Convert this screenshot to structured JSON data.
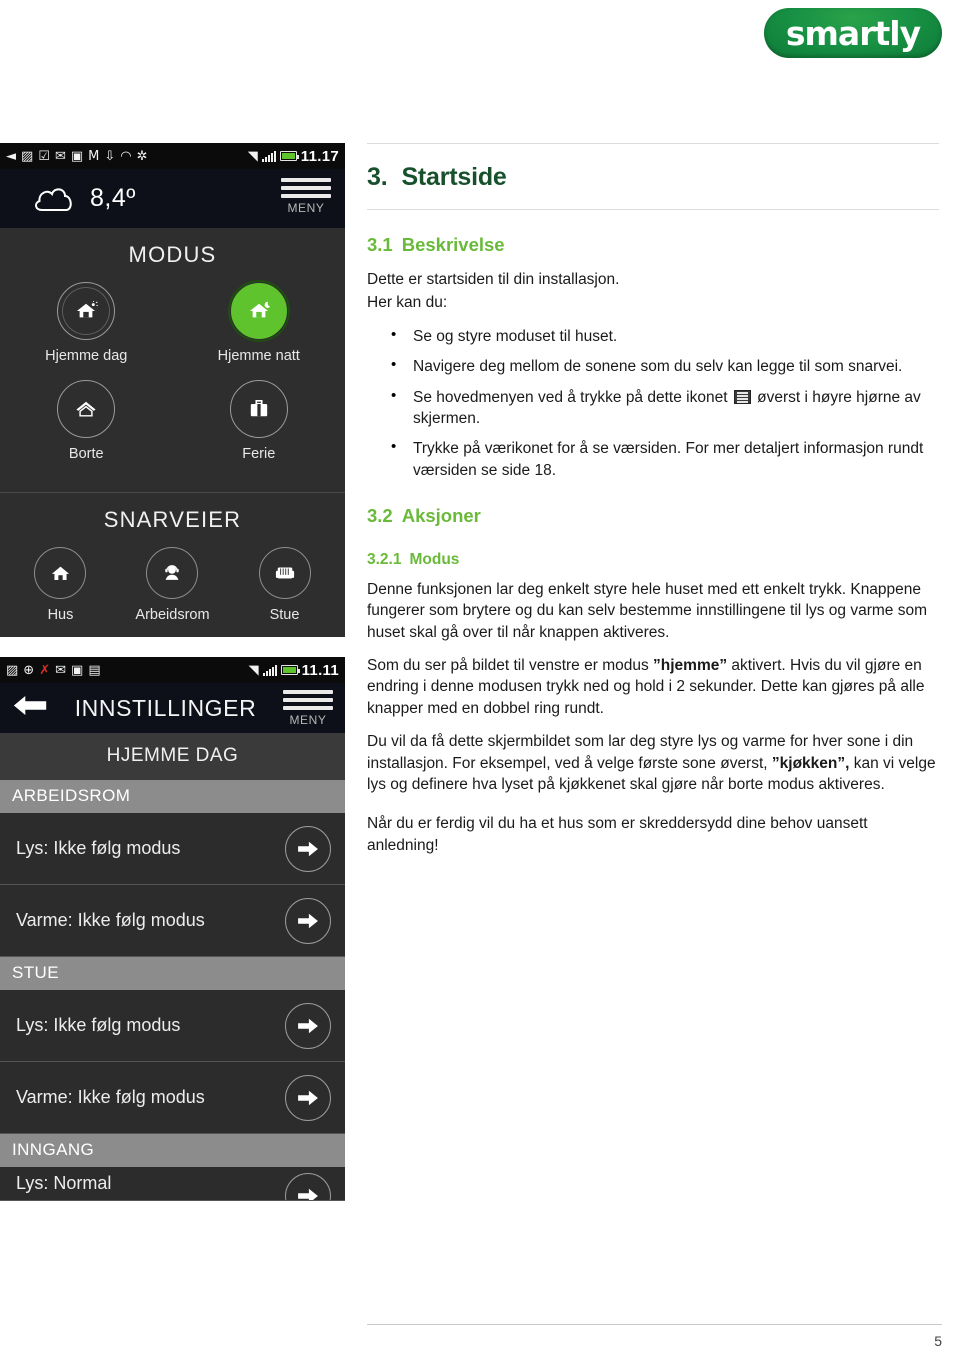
{
  "brand": {
    "name": "smartly",
    "color": "#108040"
  },
  "colors": {
    "heading_dark_green": "#16512c",
    "heading_green": "#6aba3a",
    "accent_green": "#5ec32c"
  },
  "phone_home": {
    "status_bar": {
      "time": "11.17",
      "icons": [
        "back-icon",
        "message-icon",
        "checkbox-icon",
        "envelope-icon",
        "code-icon",
        "gmail-icon",
        "usb-icon",
        "headset-icon",
        "bluetooth-icon",
        "wifi-icon",
        "signal-icon",
        "battery-icon"
      ]
    },
    "weather": {
      "temperature": "8,4º",
      "icon": "cloud-icon"
    },
    "menu_label": "MENY",
    "modus": {
      "title": "MODUS",
      "buttons": [
        {
          "label": "Hjemme dag",
          "icon": "house-sun-icon",
          "active": false
        },
        {
          "label": "Hjemme natt",
          "icon": "house-moon-icon",
          "active": true
        },
        {
          "label": "Borte",
          "icon": "house-icon",
          "active": false
        },
        {
          "label": "Ferie",
          "icon": "suitcase-icon",
          "active": false
        }
      ]
    },
    "snarveier": {
      "title": "SNARVEIER",
      "buttons": [
        {
          "label": "Hus",
          "icon": "house-filled-icon"
        },
        {
          "label": "Arbeidsrom",
          "icon": "person-headset-icon"
        },
        {
          "label": "Stue",
          "icon": "armchair-icon"
        }
      ]
    }
  },
  "phone_settings": {
    "status_bar": {
      "time": "11.11",
      "icons": [
        "message-icon",
        "download-icon",
        "missed-call-icon",
        "envelope-icon",
        "save-icon",
        "clipboard-icon",
        "wifi-icon",
        "signal-icon",
        "battery-icon"
      ]
    },
    "header": {
      "title": "INNSTILLINGER",
      "back_icon": "back-arrow-icon",
      "menu_label": "MENY"
    },
    "subtitle": "HJEMME DAG",
    "sections": [
      {
        "name": "ARBEIDSROM",
        "rows": [
          {
            "label": "Lys: Ikke følg modus",
            "action_icon": "arrow-right-icon"
          },
          {
            "label": "Varme: Ikke følg modus",
            "action_icon": "arrow-right-icon"
          }
        ]
      },
      {
        "name": "STUE",
        "rows": [
          {
            "label": "Lys: Ikke følg modus",
            "action_icon": "arrow-right-icon"
          },
          {
            "label": "Varme: Ikke følg modus",
            "action_icon": "arrow-right-icon"
          }
        ]
      },
      {
        "name": "INNGANG",
        "rows": [
          {
            "label": "Lys: Normal",
            "action_icon": "arrow-right-icon"
          }
        ]
      }
    ]
  },
  "doc": {
    "h1": {
      "num": "3.",
      "text": "Startside"
    },
    "s31": {
      "num": "3.1",
      "text": "Beskrivelse"
    },
    "intro_line1": "Dette er startsiden til din installasjon.",
    "intro_line2": "Her kan du:",
    "bullets": {
      "b1": "Se og styre moduset til huset.",
      "b2": "Navigere deg mellom de sonene som du selv kan legge til som snarvei.",
      "b3a": "Se hovedmenyen ved å trykke på dette ikonet",
      "b3b": "øverst i høyre hjørne av skjermen.",
      "b4": "Trykke på værikonet for å se værsiden. For mer detaljert informasjon rundt værsiden se side 18."
    },
    "s32": {
      "num": "3.2",
      "text": "Aksjoner"
    },
    "s321": {
      "num": "3.2.1",
      "text": "Modus"
    },
    "p1": "Denne funksjonen lar deg enkelt styre hele huset med ett enkelt trykk. Knappene fungerer som brytere og du kan selv bestemme innstillingene til lys og varme som huset skal gå over til når knappen aktiveres.",
    "p2a": "Som du ser på bildet til venstre er modus ",
    "p2b": "”hjemme”",
    "p2c": " aktivert. Hvis du vil gjøre en endring i denne modusen trykk ned og hold i 2 sekunder. Dette kan gjøres på alle knapper med en dobbel ring rundt.",
    "p3a": "Du vil da få dette skjermbildet som lar deg styre lys og varme for hver sone i din installasjon. For eksempel, ved å velge første sone øverst, ",
    "p3b": "”kjøkken”,",
    "p3c": " kan vi velge lys og definere hva lyset på kjøkkenet skal gjøre når borte modus aktiveres.",
    "p4": "Når du er ferdig vil du ha et hus som er skreddersydd dine behov uansett anledning!"
  },
  "footer": {
    "page_number": "5"
  }
}
